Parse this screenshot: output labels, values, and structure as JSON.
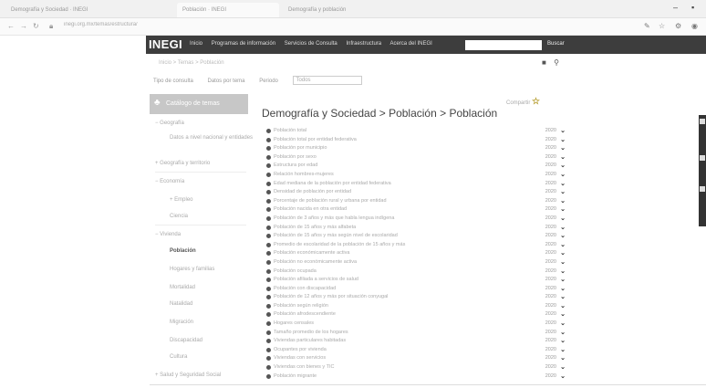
{
  "browser": {
    "tabs": [
      "Demografía y Sociedad · INEGI",
      "Población · INEGI",
      "Demografía y población"
    ],
    "url": "inegi.org.mx/temas/estructura/"
  },
  "header": {
    "logo": "INEGI",
    "nav": [
      "Inicio",
      "Programas de información",
      "Servicios de Consulta",
      "Infraestructura",
      "Acerca del INEGI"
    ],
    "search_button": "Buscar"
  },
  "breadcrumb": "Inicio > Temas > Población",
  "filters": {
    "label1": "Tipo de consulta",
    "label2": "Datos por tema",
    "label3": "Periodo",
    "select_value": "Todos"
  },
  "sidebar": {
    "header": "Catálogo de temas",
    "items": [
      {
        "label": "Geografía",
        "type": "top",
        "state": "collapsed"
      },
      {
        "label": "Datos a nivel nacional y entidades",
        "type": "sub",
        "state": ""
      },
      {
        "label": "Geografía y territorio",
        "type": "sub",
        "state": ""
      },
      {
        "label": "Economía",
        "type": "top",
        "state": "expanded"
      },
      {
        "label": "Empleo",
        "type": "top",
        "state": "expanded"
      },
      {
        "label": "Ciencia",
        "type": "sub",
        "state": ""
      },
      {
        "label": "Vivienda",
        "type": "top",
        "state": "expanded"
      },
      {
        "label": "Población",
        "type": "sub",
        "state": "active"
      },
      {
        "label": "Hogares y familias",
        "type": "sub",
        "state": ""
      },
      {
        "label": "Mortalidad",
        "type": "sub",
        "state": ""
      },
      {
        "label": "Natalidad",
        "type": "sub",
        "state": ""
      },
      {
        "label": "Migración",
        "type": "sub",
        "state": ""
      },
      {
        "label": "Discapacidad",
        "type": "sub",
        "state": ""
      },
      {
        "label": "Cultura",
        "type": "sub",
        "state": ""
      },
      {
        "label": "Salud y Seguridad Social",
        "type": "top",
        "state": "collapsed"
      }
    ]
  },
  "main": {
    "title": "Demografía y Sociedad > Población > Población",
    "share_label": "Compartir",
    "rows": [
      {
        "text": "Población total",
        "value": "2020"
      },
      {
        "text": "Población total por entidad federativa",
        "value": "2020"
      },
      {
        "text": "Población por municipio",
        "value": "2020"
      },
      {
        "text": "Población por sexo",
        "value": "2020"
      },
      {
        "text": "Estructura por edad",
        "value": "2020"
      },
      {
        "text": "Relación hombres-mujeres",
        "value": "2020"
      },
      {
        "text": "Edad mediana de la población por entidad federativa",
        "value": "2020"
      },
      {
        "text": "Densidad de población por entidad",
        "value": "2020"
      },
      {
        "text": "Porcentaje de población rural y urbana por entidad",
        "value": "2020"
      },
      {
        "text": "Población nacida en otra entidad",
        "value": "2020"
      },
      {
        "text": "Población de 3 años y más que habla lengua indígena",
        "value": "2020"
      },
      {
        "text": "Población de 15 años y más alfabeta",
        "value": "2020"
      },
      {
        "text": "Población de 15 años y más según nivel de escolaridad",
        "value": "2020"
      },
      {
        "text": "Promedio de escolaridad de la población de 15 años y más",
        "value": "2020"
      },
      {
        "text": "Población económicamente activa",
        "value": "2020"
      },
      {
        "text": "Población no económicamente activa",
        "value": "2020"
      },
      {
        "text": "Población ocupada",
        "value": "2020"
      },
      {
        "text": "Población afiliada a servicios de salud",
        "value": "2020"
      },
      {
        "text": "Población con discapacidad",
        "value": "2020"
      },
      {
        "text": "Población de 12 años y más por situación conyugal",
        "value": "2020"
      },
      {
        "text": "Población según religión",
        "value": "2020"
      },
      {
        "text": "Población afrodescendiente",
        "value": "2020"
      },
      {
        "text": "Hogares censales",
        "value": "2020"
      },
      {
        "text": "Tamaño promedio de los hogares",
        "value": "2020"
      },
      {
        "text": "Viviendas particulares habitadas",
        "value": "2020"
      },
      {
        "text": "Ocupantes por vivienda",
        "value": "2020"
      },
      {
        "text": "Viviendas con servicios",
        "value": "2020"
      },
      {
        "text": "Viviendas con bienes y TIC",
        "value": "2020"
      },
      {
        "text": "Población migrante",
        "value": "2020"
      }
    ]
  }
}
